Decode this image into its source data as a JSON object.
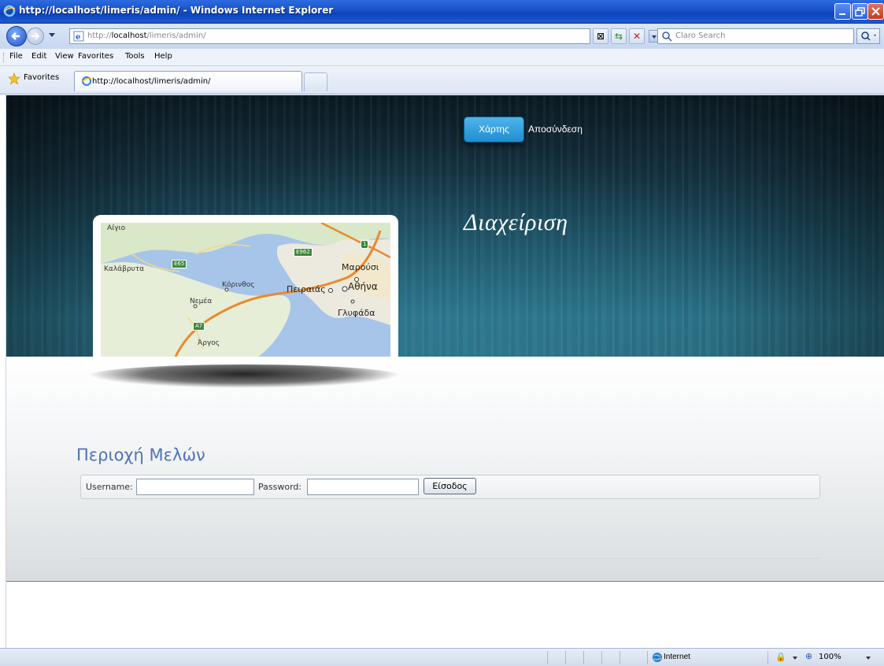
{
  "window": {
    "title": "http://localhost/limeris/admin/ - Windows Internet Explorer"
  },
  "address_bar": {
    "url_prefix": "http://",
    "url_host": "localhost",
    "url_path": "/limeris/admin/",
    "search_placeholder": "Claro Search"
  },
  "menu": {
    "items": [
      "File",
      "Edit",
      "View",
      "Favorites",
      "Tools",
      "Help"
    ]
  },
  "favorites_bar": {
    "label": "Favorites",
    "tab_title": "http://localhost/limeris/admin/"
  },
  "site": {
    "nav": {
      "map_button": "Χάρτης",
      "logout_link": "Αποσύνδεση"
    },
    "hero_title": "Διαχείριση",
    "map_labels": {
      "aigio": "Αίγιο",
      "kalavryta": "Καλάβρυτα",
      "korinthos": "Κόρινθος",
      "nemea": "Νεμέα",
      "argos": "Άργος",
      "peiraias": "Πειραιάς",
      "athina": "Αθήνα",
      "marousi": "Μαρούσι",
      "glyfada": "Γλυφάδα",
      "e65": "E65",
      "e962": "E962",
      "a7": "A7",
      "r1": "1"
    },
    "members": {
      "title": "Περιοχή Μελών",
      "username_label": "Username:",
      "password_label": "Password:",
      "submit_label": "Είσοδος"
    }
  },
  "status_bar": {
    "zone": "Internet",
    "zoom": "100%"
  },
  "colors": {
    "accent_button": "#2b9ad9",
    "section_title": "#4f73b9",
    "titlebar": "#1850c8"
  }
}
